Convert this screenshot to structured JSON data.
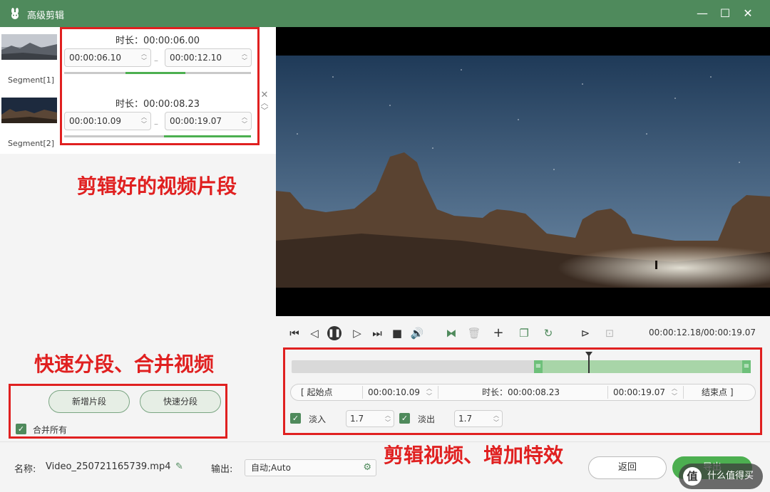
{
  "window": {
    "title": "高级剪辑",
    "minimize": "—",
    "maximize": "☐",
    "close": "✕"
  },
  "segments": [
    {
      "label": "Segment[1]",
      "duration": "时长：00:00:06.00",
      "start": "00:00:06.10",
      "end": "00:00:12.10"
    },
    {
      "label": "Segment[2]",
      "duration": "时长：00:00:08.23",
      "start": "00:00:10.09",
      "end": "00:00:19.07"
    }
  ],
  "annotations": {
    "segments": "剪辑好的视频片段",
    "split_merge": "快速分段、合并视频",
    "edit_effects": "剪辑视频、增加特效"
  },
  "left_actions": {
    "add_segment": "新增片段",
    "quick_split": "快速分段",
    "merge_all": "合并所有"
  },
  "player": {
    "timecode": "00:00:12.18/00:00:19.07"
  },
  "editor": {
    "start_point": "[ 起始点",
    "start_time": "00:00:10.09",
    "duration": "时长：00:00:08.23",
    "end_time": "00:00:19.07",
    "end_point": "结束点 ]",
    "fade_in_label": "淡入",
    "fade_in_value": "1.7",
    "fade_out_label": "淡出",
    "fade_out_value": "1.7"
  },
  "bottom": {
    "name_label": "名称:",
    "file_name": "Video_250721165739.mp4",
    "output_label": "输出:",
    "output_value": "自动;Auto",
    "back": "返回",
    "export": "导出",
    "watermark": "值 什么值得买"
  },
  "colors": {
    "accent": "#4f8a5c",
    "annotation_red": "#e02020",
    "progress_green": "#4caf50"
  }
}
